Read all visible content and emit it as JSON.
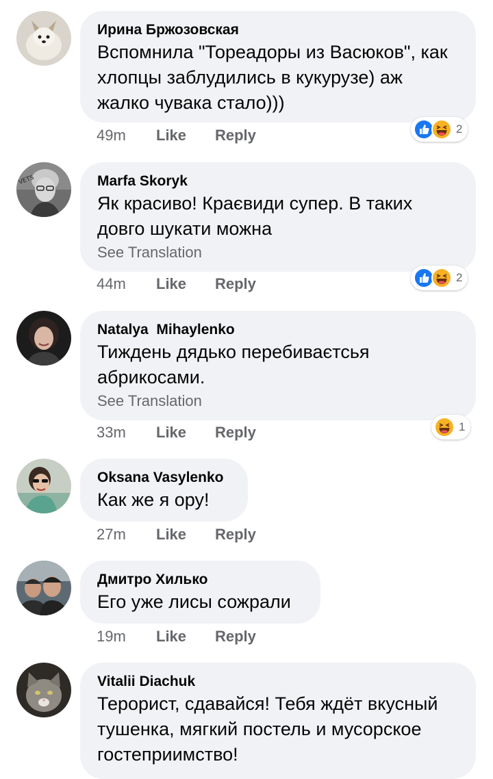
{
  "comments": [
    {
      "author": "Ирина Бржозовская",
      "text": "Вспомнила \"Тореадоры из Васюков\", как хлопцы заблудились в кукурузе) аж жалко чувака стало)))",
      "time": "49m",
      "like": "Like",
      "reply": "Reply",
      "reactions": [
        "like-icon",
        "haha-icon"
      ],
      "reaction_count": "2"
    },
    {
      "author": "Marfa Skoryk",
      "text": "Як красиво! Краєвиди супер. В таких довго шукати можна",
      "see_translation": "See Translation",
      "time": "44m",
      "like": "Like",
      "reply": "Reply",
      "reactions": [
        "like-icon",
        "haha-icon"
      ],
      "reaction_count": "2"
    },
    {
      "author": "Natalya  Mihaylenko",
      "text": "Тиждень дядько перебиваєтсья абрикосами.",
      "see_translation": "See Translation",
      "time": "33m",
      "like": "Like",
      "reply": "Reply",
      "reactions": [
        "haha-icon"
      ],
      "reaction_count": "1"
    },
    {
      "author": "Oksana Vasylenko",
      "text": "Как же я ору!",
      "time": "27m",
      "like": "Like",
      "reply": "Reply"
    },
    {
      "author": "Дмитро Хилько",
      "text": "Его уже лисы сожрали",
      "time": "19m",
      "like": "Like",
      "reply": "Reply"
    },
    {
      "author": "Vitalii Diachuk",
      "text": "Терорист, сдавайся! Тебя ждёт вкусный тушенка, мягкий постель и мусорское гостеприимство!"
    }
  ],
  "colors": {
    "bubble_bg": "#f0f2f5",
    "meta_text": "#65676b",
    "like_blue": "#1877f2",
    "haha_yellow": "#f7b125"
  }
}
